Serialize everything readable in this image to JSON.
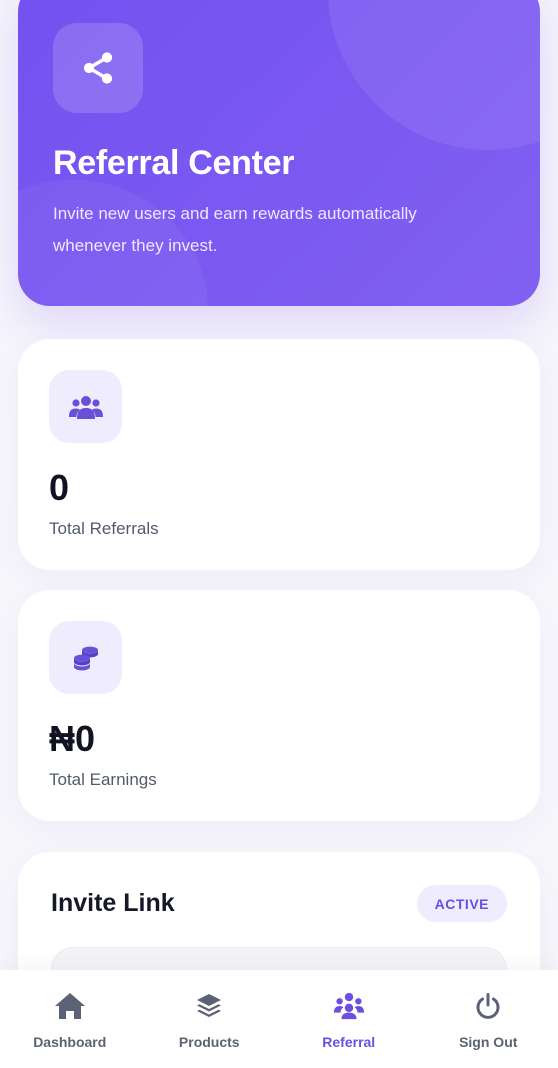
{
  "hero": {
    "title": "Referral Center",
    "description": "Invite new users and earn rewards automatically whenever they invest.",
    "icon": "share-icon"
  },
  "stats": {
    "referrals": {
      "value": "0",
      "label": "Total Referrals",
      "icon": "users-icon"
    },
    "earnings": {
      "value": "₦0",
      "label": "Total Earnings",
      "icon": "coins-icon"
    }
  },
  "invite": {
    "title": "Invite Link",
    "status": "ACTIVE"
  },
  "nav": {
    "items": [
      {
        "label": "Dashboard",
        "icon": "home-icon",
        "active": false
      },
      {
        "label": "Products",
        "icon": "layers-icon",
        "active": false
      },
      {
        "label": "Referral",
        "icon": "users-icon",
        "active": true
      },
      {
        "label": "Sign Out",
        "icon": "power-icon",
        "active": false
      }
    ]
  },
  "colors": {
    "accent": "#7251f0",
    "accent_light": "#efedfd",
    "text_dark": "#111322",
    "text_muted": "#525a6c"
  }
}
